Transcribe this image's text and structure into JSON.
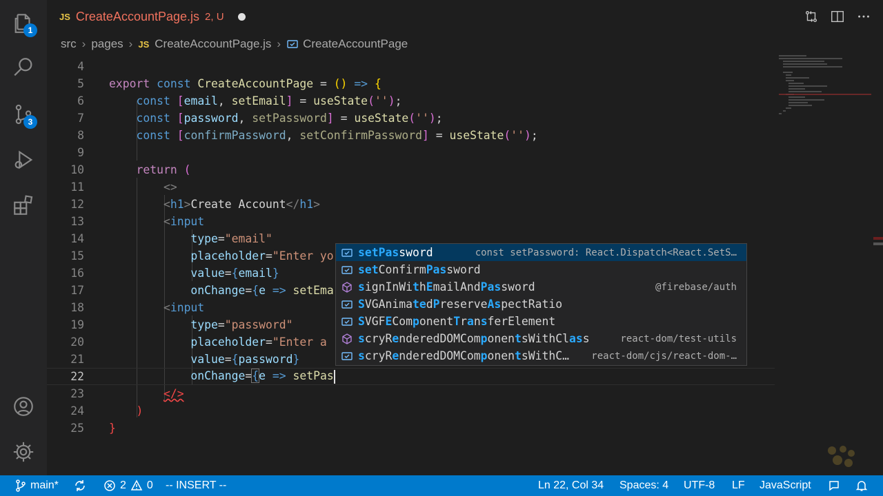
{
  "tab": {
    "lang_badge": "JS",
    "filename": "CreateAccountPage.js",
    "status": "2, U"
  },
  "breadcrumb": {
    "folder1": "src",
    "folder2": "pages",
    "lang_badge": "JS",
    "file": "CreateAccountPage.js",
    "symbol": "CreateAccountPage"
  },
  "activity_bar": {
    "explorer_badge": "1",
    "scm_badge": "3"
  },
  "editor": {
    "line_numbers": [
      "4",
      "5",
      "6",
      "7",
      "8",
      "9",
      "10",
      "11",
      "12",
      "13",
      "14",
      "15",
      "16",
      "17",
      "18",
      "19",
      "20",
      "21",
      "22",
      "23",
      "24",
      "25"
    ],
    "current_line": "22"
  },
  "suggestions": [
    {
      "label": "setPassword",
      "detail": "const setPassword: React.Dispatch<React.SetS…",
      "kind": "variable-icon"
    },
    {
      "label": "setConfirmPassword",
      "detail": "",
      "kind": "variable-icon"
    },
    {
      "label": "signInWithEmailAndPassword",
      "detail": "@firebase/auth",
      "kind": "method-icon"
    },
    {
      "label": "SVGAnimatedPreserveAspectRatio",
      "detail": "",
      "kind": "variable-icon"
    },
    {
      "label": "SVGFEComponentTransferElement",
      "detail": "",
      "kind": "variable-icon"
    },
    {
      "label": "scryRenderedDOMComponentsWithClass",
      "detail": "react-dom/test-utils",
      "kind": "method-icon"
    },
    {
      "label": "scryRenderedDOMComponentsWithC…",
      "detail": "react-dom/cjs/react-dom-…",
      "kind": "variable-icon"
    }
  ],
  "statusbar": {
    "branch": "main*",
    "errors": "2",
    "warnings": "0",
    "mode": "-- INSERT --",
    "position": "Ln 22, Col 34",
    "spaces": "Spaces: 4",
    "encoding": "UTF-8",
    "eol": "LF",
    "language": "JavaScript"
  },
  "colors": {
    "accent": "#007acc",
    "selection": "#04395e",
    "error_text": "#f0725e"
  }
}
